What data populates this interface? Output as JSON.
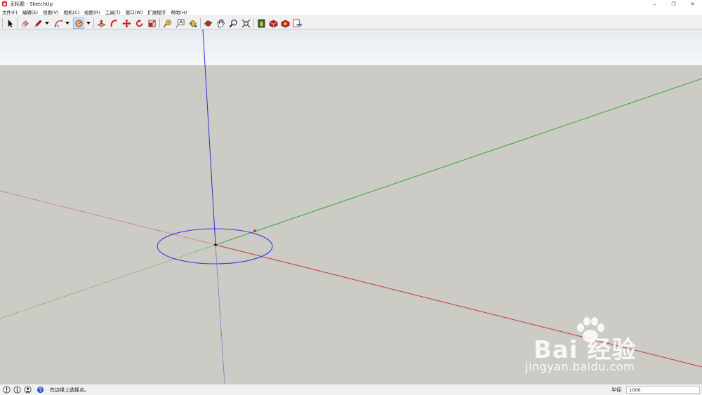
{
  "window": {
    "title": "无标题 - SketchUp",
    "controls": {
      "minimize": "–",
      "restore": "❐",
      "close": "✕"
    }
  },
  "menu": {
    "items": [
      "文件(F)",
      "编辑(E)",
      "视图(V)",
      "相机(C)",
      "绘图(R)",
      "工具(T)",
      "窗口(W)",
      "扩展程序",
      "帮助(H)"
    ]
  },
  "toolbar": {
    "tools": [
      "select",
      "eraser",
      "line",
      "line-dropdown",
      "arc",
      "arc-dropdown",
      "circle",
      "circle-dropdown",
      "push-pull",
      "follow-me",
      "move",
      "rotate",
      "scale",
      "tape-measure",
      "text",
      "paint-bucket",
      "orbit",
      "pan",
      "zoom",
      "zoom-extents",
      "warehouse",
      "extension-warehouse",
      "layout",
      "send-to-layout"
    ],
    "active_tool": "circle"
  },
  "status": {
    "hint": "在边缘上选择点。",
    "measure_label": "半径",
    "measure_value": "1000"
  },
  "watermark": {
    "logo": "Bai 经验",
    "url": "jingyan.baidu.com"
  },
  "colors": {
    "sky_top": "#e4ebf1",
    "ground": "#cccbc5",
    "axis_red": "#c23a3a",
    "axis_green": "#3aa83a",
    "axis_blue": "#3030c8",
    "circle": "#3b3be0",
    "active_tool_bg": "#cfe3f7"
  }
}
